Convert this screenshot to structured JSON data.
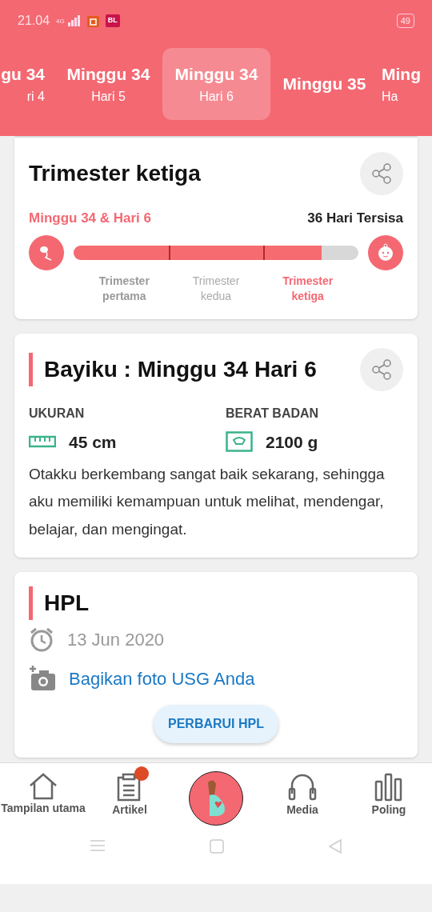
{
  "status_bar": {
    "time": "21.04",
    "network": "4G",
    "app_badge": "BL",
    "battery": "49"
  },
  "week_tabs": [
    {
      "week": "gu 34",
      "day": "ri 4",
      "selected": false
    },
    {
      "week": "Minggu 34",
      "day": "Hari 5",
      "selected": false
    },
    {
      "week": "Minggu 34",
      "day": "Hari 6",
      "selected": true
    },
    {
      "week": "Minggu 35",
      "selected": false
    },
    {
      "week": "Ming",
      "day": "Ha",
      "selected": false
    }
  ],
  "trimester_card": {
    "title": "Trimester ketiga",
    "current": "Minggu 34 & Hari 6",
    "remaining": "36 Hari Tersisa",
    "level": 0.87,
    "stages": [
      {
        "label": "Trimester pertama",
        "kind": "past"
      },
      {
        "label": "Trimester kedua",
        "kind": "future"
      },
      {
        "label": "Trimester ketiga",
        "kind": "current"
      }
    ]
  },
  "baby_card": {
    "title": "Bayiku : Minggu 34 Hari 6",
    "stats": [
      {
        "label": "UKURAN",
        "value": "45 cm",
        "kind": "size"
      },
      {
        "label": "BERAT BADAN",
        "value": "2100 g",
        "kind": "weight"
      }
    ],
    "description": "Otakku berkembang sangat baik sekarang, sehingga aku memiliki kemampuan untuk melihat, mendengar, belajar, dan mengingat."
  },
  "hpl_card": {
    "title": "HPL",
    "date": "13 Jun 2020",
    "share_link": "Bagikan foto USG Anda",
    "button": "PERBARUI HPL"
  },
  "bottom_nav": [
    {
      "label": "Tampilan utama",
      "kind": "home",
      "badge": false
    },
    {
      "label": "Artikel",
      "kind": "article",
      "badge": true
    },
    {
      "kind": "center",
      "badge": false
    },
    {
      "label": "Media",
      "kind": "media",
      "badge": false
    },
    {
      "label": "Poling",
      "kind": "poll",
      "badge": false
    }
  ]
}
